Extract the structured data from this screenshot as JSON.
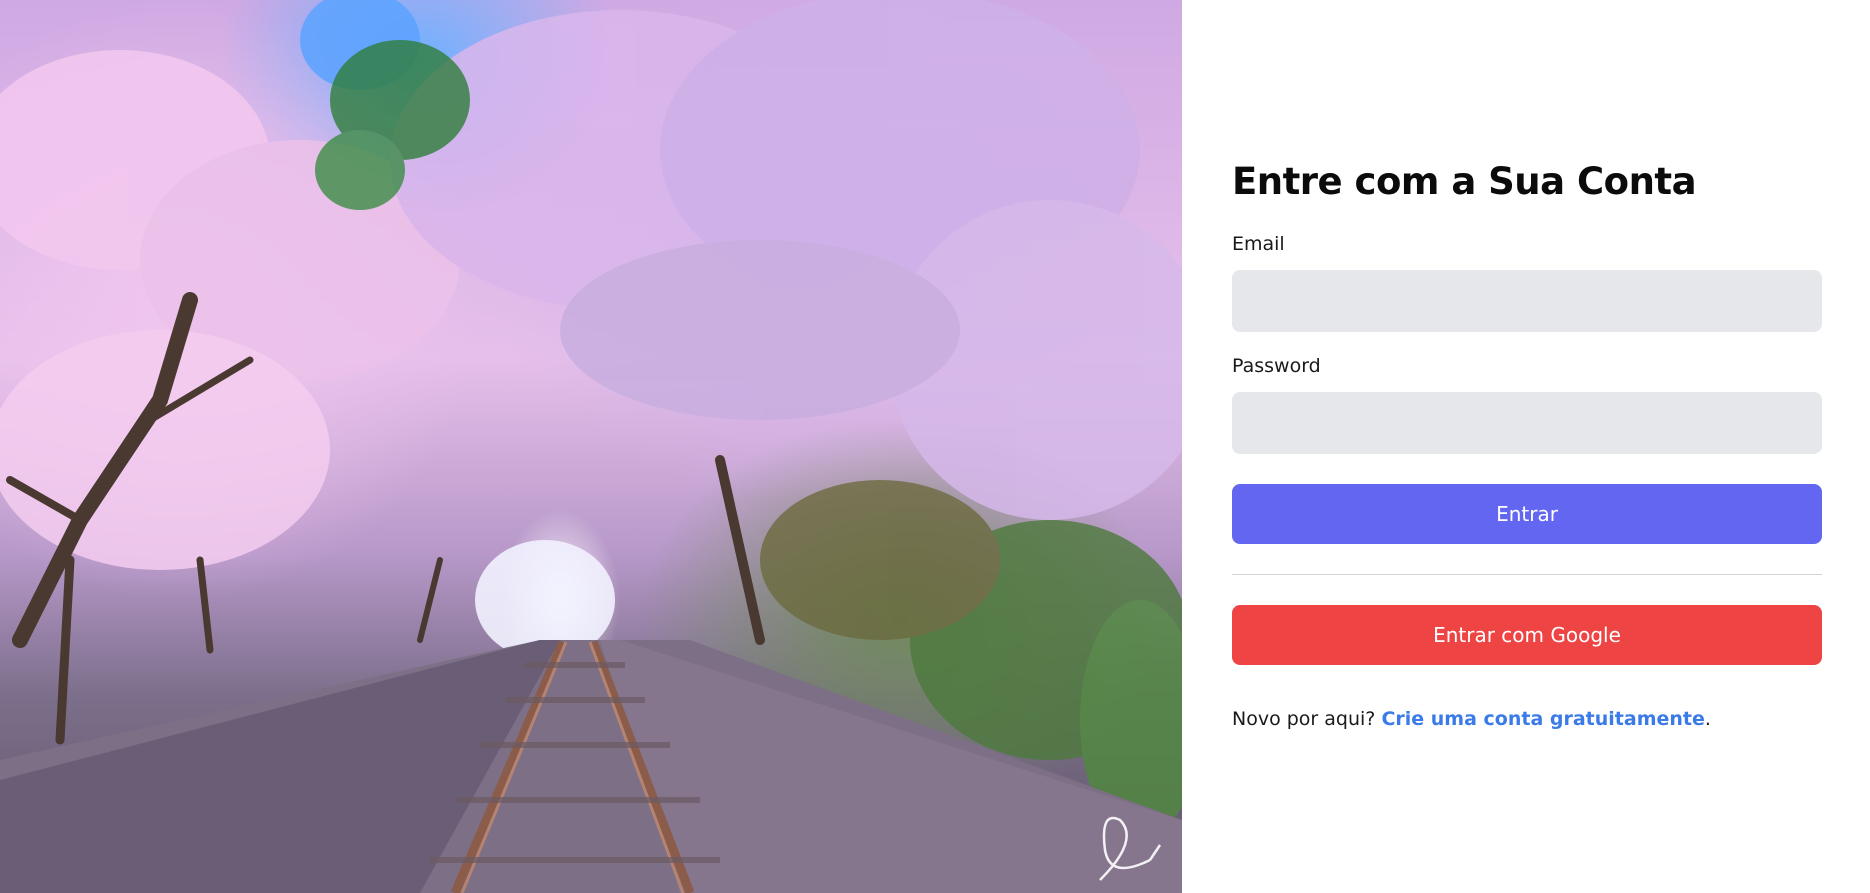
{
  "hero": {
    "alt": "Cherry blossom tunnel over railway tracks",
    "signature": "Di"
  },
  "login": {
    "title": "Entre com a Sua Conta",
    "email_label": "Email",
    "email_value": "",
    "email_placeholder": "",
    "password_label": "Password",
    "password_value": "",
    "password_placeholder": "",
    "submit_label": "Entrar",
    "google_label": "Entrar com Google",
    "signup_prefix": "Novo por aqui? ",
    "signup_link": "Crie uma conta gratuitamente",
    "signup_suffix": "."
  },
  "colors": {
    "primary": "#6366f1",
    "google": "#ef4444",
    "link": "#3b7be8",
    "input_bg": "#e6e7ea"
  }
}
